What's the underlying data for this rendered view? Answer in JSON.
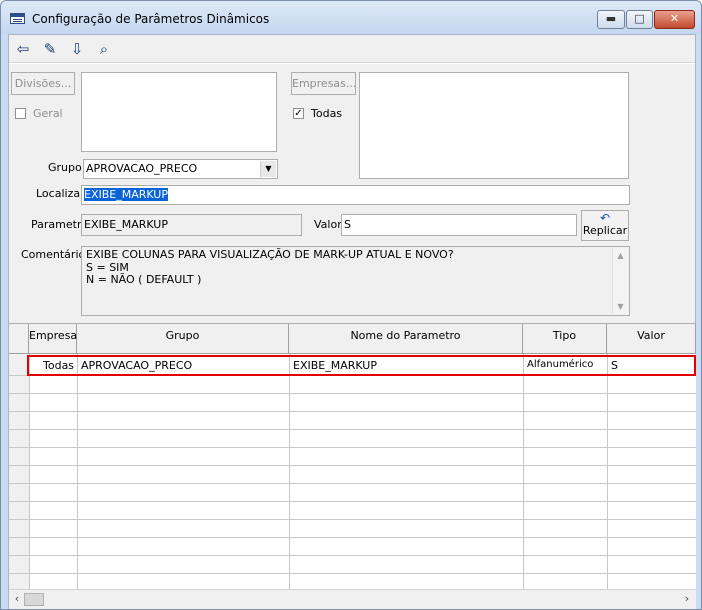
{
  "window": {
    "title": "Configuração de Parâmetros Dinâmicos",
    "min_glyph": "▬",
    "max_glyph": "□",
    "close_glyph": "✕"
  },
  "toolbar": [
    {
      "name": "exit-icon",
      "glyph": "⇦"
    },
    {
      "name": "edit-icon",
      "glyph": "✎"
    },
    {
      "name": "download-icon",
      "glyph": "⇩"
    },
    {
      "name": "binoculars-icon",
      "glyph": "⌕"
    }
  ],
  "form": {
    "divisoes_button": "Divisões...",
    "geral_label": "Geral",
    "geral_checked": false,
    "empresas_button": "Empresas...",
    "todas_label": "Todas",
    "todas_checked": true,
    "todas_check_glyph": "✓",
    "grupo_label": "Grupo",
    "grupo_value": "APROVACAO_PRECO",
    "combo_arrow": "▼",
    "localizar_label": "Localizar",
    "localizar_value": "EXIBE_MARKUP",
    "parametro_label": "Parametro",
    "parametro_value": "EXIBE_MARKUP",
    "valor_label": "Valor",
    "valor_value": "S",
    "replicar_label": "Replicar",
    "replicar_glyph": "↶",
    "comentarios_label": "Comentários",
    "comentarios_text": "EXIBE COLUNAS PARA VISUALIZAÇÃO DE MARK-UP ATUAL E NOVO?\nS = SIM\nN = NÃO ( DEFAULT )",
    "scroll_up": "▲",
    "scroll_down": "▼"
  },
  "grid": {
    "columns": [
      "Empresa",
      "Grupo",
      "Nome do Parametro",
      "Tipo",
      "Valor"
    ],
    "rows": [
      {
        "empresa": "Todas",
        "grupo": "APROVACAO_PRECO",
        "nome": "EXIBE_MARKUP",
        "tipo": "Alfanumérico",
        "valor": "S"
      }
    ],
    "scroll_left": "‹",
    "scroll_right": "›"
  },
  "colors": {
    "highlight_border": "#e00000",
    "selection": "#0a64d8"
  }
}
